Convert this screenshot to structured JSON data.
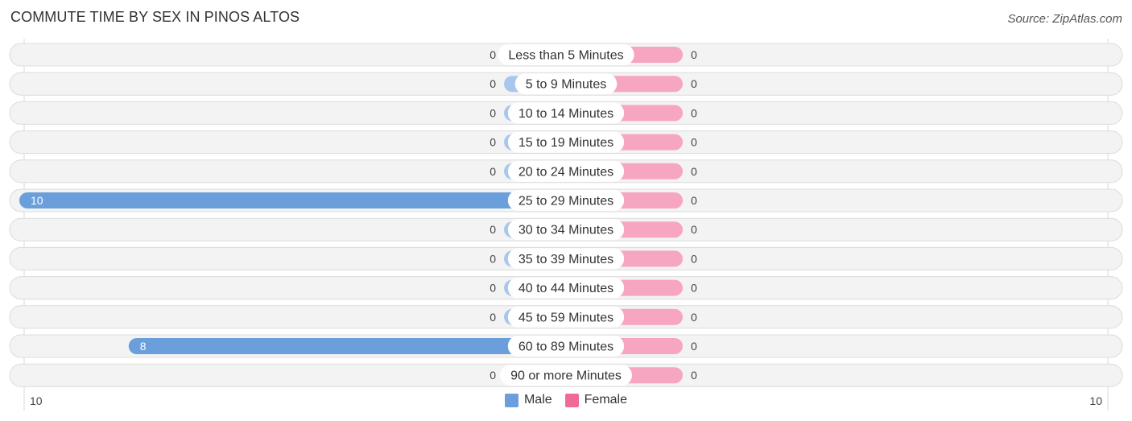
{
  "title": "COMMUTE TIME BY SEX IN PINOS ALTOS",
  "source": "Source: ZipAtlas.com",
  "colors": {
    "male_bar": "#6a9fdc",
    "male_bar_zero": "#a9c7ec",
    "female_bar": "#f7a6c1",
    "female_legend": "#f06a98",
    "male_legend": "#6a9fdc",
    "row_bg": "#f3f3f3"
  },
  "legend": [
    {
      "label": "Male",
      "color": "#6a9fdc"
    },
    {
      "label": "Female",
      "color": "#f06a98"
    }
  ],
  "axis": {
    "left_label": "10",
    "right_label": "10"
  },
  "chart_data": {
    "type": "bar",
    "orientation": "horizontal-diverging",
    "title": "COMMUTE TIME BY SEX IN PINOS ALTOS",
    "categories": [
      "Less than 5 Minutes",
      "5 to 9 Minutes",
      "10 to 14 Minutes",
      "15 to 19 Minutes",
      "20 to 24 Minutes",
      "25 to 29 Minutes",
      "30 to 34 Minutes",
      "35 to 39 Minutes",
      "40 to 44 Minutes",
      "45 to 59 Minutes",
      "60 to 89 Minutes",
      "90 or more Minutes"
    ],
    "series": [
      {
        "name": "Male",
        "values": [
          0,
          0,
          0,
          0,
          0,
          10,
          0,
          0,
          0,
          0,
          8,
          0
        ]
      },
      {
        "name": "Female",
        "values": [
          0,
          0,
          0,
          0,
          0,
          0,
          0,
          0,
          0,
          0,
          0,
          0
        ]
      }
    ],
    "xlim": [
      -10,
      10
    ],
    "tick_labels": [
      "10",
      "10"
    ],
    "legend_position": "bottom-center"
  }
}
